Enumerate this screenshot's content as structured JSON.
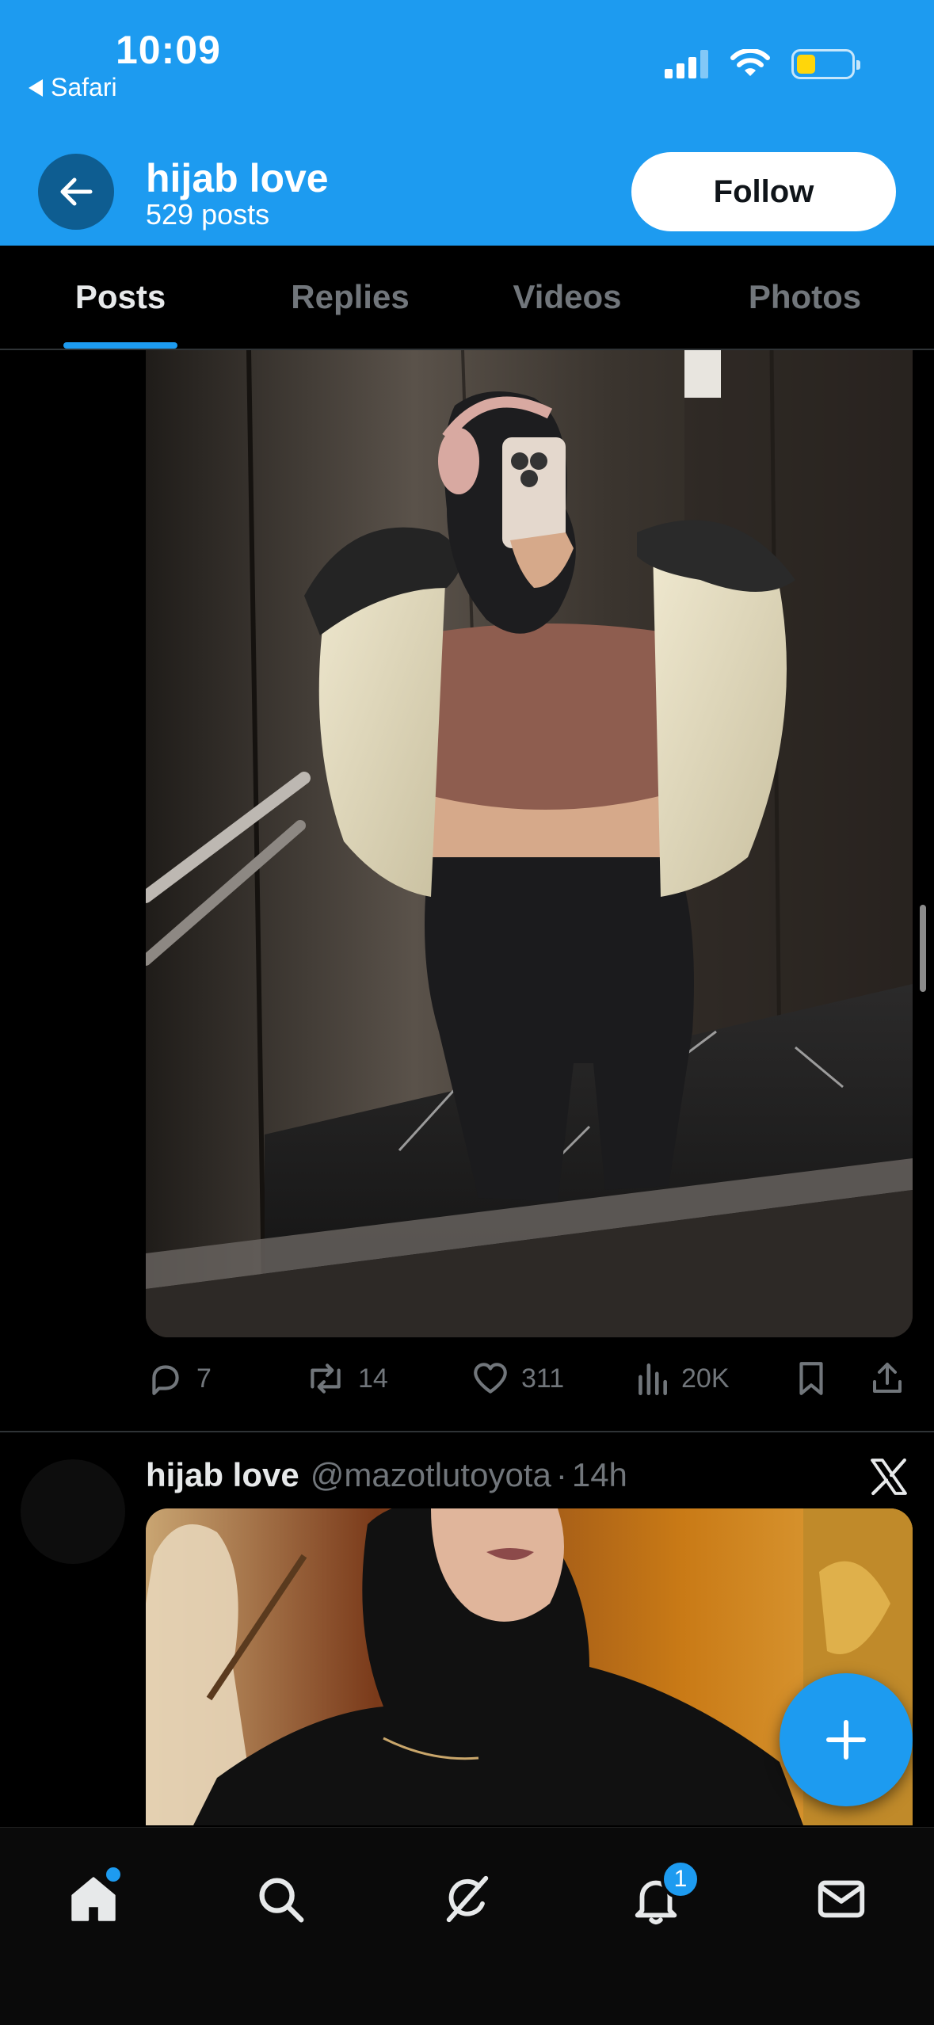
{
  "status_bar": {
    "time": "10:09",
    "back_app": "Safari",
    "icons": [
      "cellular-signal-icon",
      "wifi-icon",
      "battery-icon"
    ],
    "battery_level": 0.35
  },
  "profile_header": {
    "name": "hijab love",
    "post_count": "529 posts",
    "follow_label": "Follow"
  },
  "tabs": [
    {
      "label": "Posts",
      "active": true
    },
    {
      "label": "Replies",
      "active": false
    },
    {
      "label": "Videos",
      "active": false
    },
    {
      "label": "Photos",
      "active": false
    }
  ],
  "posts": [
    {
      "media": "photo",
      "actions": {
        "replies": "7",
        "reposts": "14",
        "likes": "311",
        "views": "20K"
      }
    },
    {
      "author_name": "hijab love",
      "author_handle": "@mazotlutoyota",
      "separator": "·",
      "time": "14h",
      "source_icon": "x-logo-icon",
      "media": "photo"
    }
  ],
  "bottom_nav": {
    "items": [
      "home-icon",
      "search-icon",
      "grok-icon",
      "notifications-icon",
      "messages-icon"
    ],
    "notification_badge": "1"
  },
  "colors": {
    "accent": "#1d9bf0",
    "background": "#000000",
    "secondary_text": "#71767b",
    "primary_text": "#e7e9ea"
  }
}
